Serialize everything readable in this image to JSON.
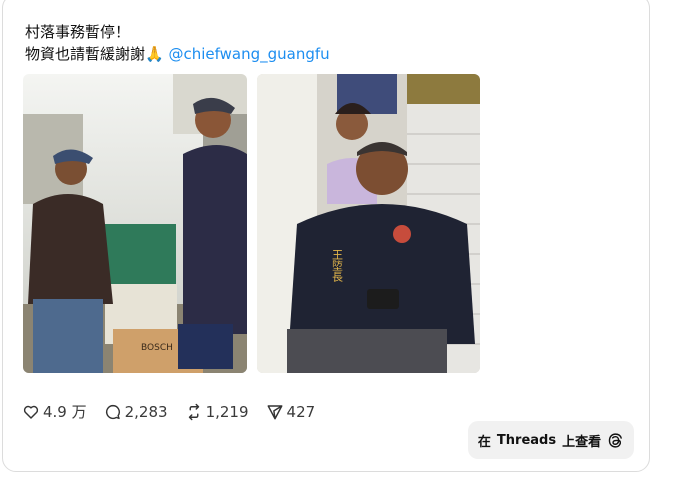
{
  "post": {
    "line1": "村落事務暫停！",
    "line2_prefix": "物資也請暫緩謝謝",
    "line2_emoji": "🙏",
    "mention": "@chiefwang_guangfu"
  },
  "photos": [
    {
      "icon": "photo-volunteer-with-supplies"
    },
    {
      "icon": "photo-village-chief-with-child"
    }
  ],
  "photo_text": {
    "vest_label": "王埅長",
    "box_brand": "BOSCH"
  },
  "stats": {
    "likes": "4.9 万",
    "replies": "2,283",
    "reposts": "1,219",
    "shares": "427"
  },
  "threads_button": {
    "label_prefix": "在",
    "label_brand": "Threads",
    "label_suffix": "上查看"
  },
  "colors": {
    "mention": "#1d8ef0",
    "button_bg": "#f1f1f1"
  }
}
